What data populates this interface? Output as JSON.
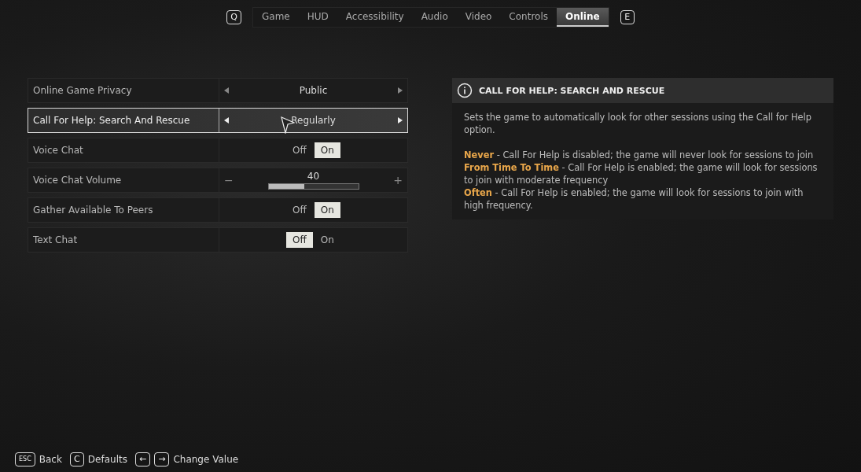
{
  "tab_bar": {
    "prev_key": "Q",
    "next_key": "E",
    "tabs": [
      {
        "label": "Game",
        "selected": false
      },
      {
        "label": "HUD",
        "selected": false
      },
      {
        "label": "Accessibility",
        "selected": false
      },
      {
        "label": "Audio",
        "selected": false
      },
      {
        "label": "Video",
        "selected": false
      },
      {
        "label": "Controls",
        "selected": false
      },
      {
        "label": "Online",
        "selected": true
      }
    ]
  },
  "settings": [
    {
      "kind": "selector",
      "label": "Online Game Privacy",
      "value": "Public",
      "focused": false
    },
    {
      "kind": "selector",
      "label": "Call For Help: Search And Rescue",
      "value": "Regularly",
      "focused": true
    },
    {
      "kind": "toggle",
      "label": "Voice Chat",
      "off_label": "Off",
      "on_label": "On",
      "on": true,
      "focused": false
    },
    {
      "kind": "slider",
      "label": "Voice Chat Volume",
      "reading": "40",
      "level": 0.4,
      "minus": "−",
      "plus": "+",
      "focused": false
    },
    {
      "kind": "toggle",
      "label": "Gather Available To Peers",
      "off_label": "Off",
      "on_label": "On",
      "on": true,
      "focused": false
    },
    {
      "kind": "toggle",
      "label": "Text Chat",
      "off_label": "Off",
      "on_label": "On",
      "on": false,
      "focused": false
    }
  ],
  "info_panel": {
    "title": "CALL FOR HELP: SEARCH AND RESCUE",
    "description": "Sets the game to automatically look for other sessions using the Call for Help option.",
    "options": [
      {
        "term": "Never",
        "text": " - Call For Help is disabled; the game will never look for sessions to join"
      },
      {
        "term": "From Time To Time",
        "text": " - Call For Help is enabled; the game will look for sessions to join with moderate frequency"
      },
      {
        "term": "Often",
        "text": " - Call For Help is enabled; the game will look for sessions to join with high frequency."
      }
    ]
  },
  "footer_hints": [
    {
      "keys": [
        "ESC"
      ],
      "label": "Back"
    },
    {
      "keys": [
        "C"
      ],
      "label": "Defaults"
    },
    {
      "keys": [
        "←",
        "→"
      ],
      "label": "Change Value"
    }
  ]
}
